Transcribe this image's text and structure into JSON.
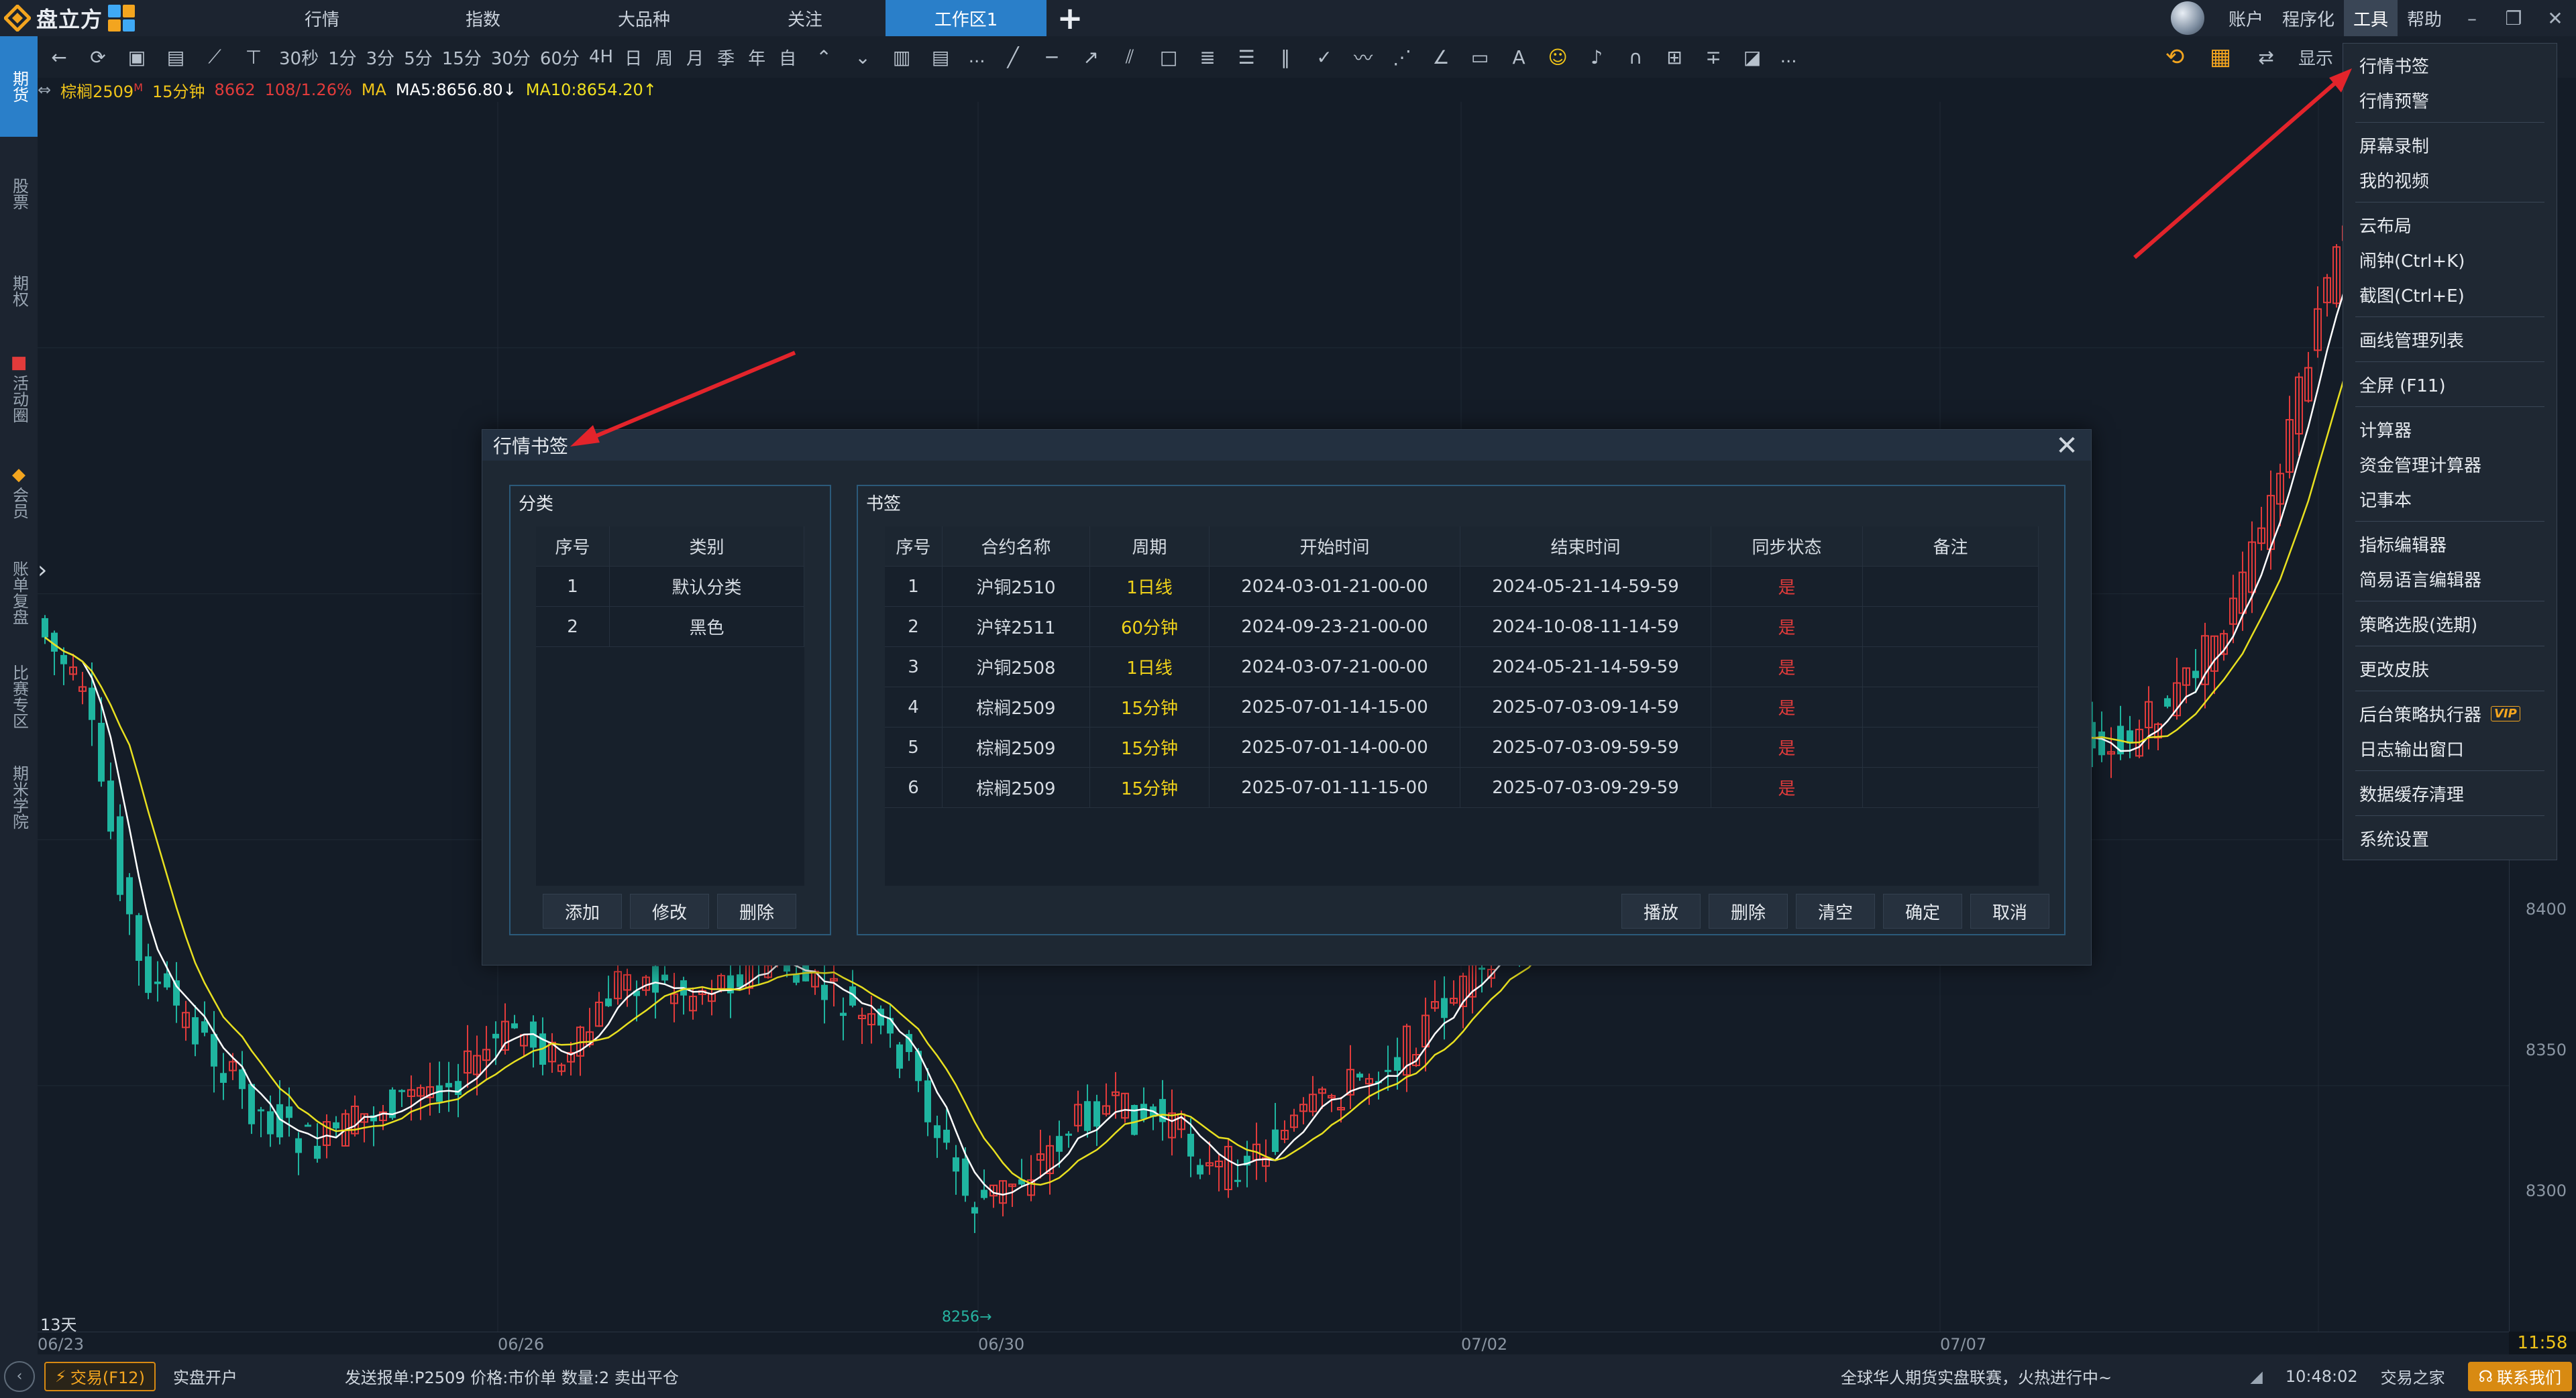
{
  "app": {
    "logo_text": "盘立方",
    "tabs": [
      "行情",
      "指数",
      "大品种",
      "关注",
      "工作区1"
    ],
    "active_tab": "工作区1",
    "right_menus": [
      "账户",
      "程序化",
      "工具",
      "帮助"
    ],
    "window_controls": [
      "minimize-icon",
      "restore-icon",
      "close-icon"
    ]
  },
  "toolbar": {
    "periods": [
      "30秒",
      "1分",
      "3分",
      "5分",
      "15分",
      "30分",
      "60分",
      "4H",
      "日",
      "周",
      "月",
      "季",
      "年",
      "自"
    ],
    "more": "...",
    "display_label": "显示"
  },
  "sidebar": {
    "items": [
      "期货",
      "股票",
      "期权",
      "活动圈",
      "会员",
      "账单复盘",
      "比赛专区",
      "期米学院"
    ]
  },
  "chart": {
    "info": {
      "symbol": "棕榈2509",
      "symbol_badge": "M",
      "period": "15分钟",
      "price": "8662",
      "change": "108/1.26%",
      "ma_label": "MA",
      "ma5": "MA5:8656.80↓",
      "ma10": "MA10:8654.20↑"
    },
    "days_label": "13天",
    "min_label": "8256→",
    "price_ticks": [
      "8400",
      "8350",
      "8300"
    ],
    "time_ticks": [
      "06/23",
      "06/26",
      "06/30",
      "07/02",
      "07/07"
    ],
    "clock": "11:58",
    "colors": {
      "up": "#e23b3b",
      "down": "#1fb5a0",
      "ma5": "#ffffff",
      "ma10": "#e8e020",
      "accent": "#2a7fc9"
    }
  },
  "dropdown": {
    "groups": [
      [
        "行情书签",
        "行情预警"
      ],
      [
        "屏幕录制",
        "我的视频"
      ],
      [
        "云布局",
        "闹钟(Ctrl+K)",
        "截图(Ctrl+E)"
      ],
      [
        "画线管理列表"
      ],
      [
        "全屏 (F11)"
      ],
      [
        "计算器",
        "资金管理计算器",
        "记事本"
      ],
      [
        "指标编辑器",
        "简易语言编辑器"
      ],
      [
        "策略选股(选期)"
      ],
      [
        "更改皮肤"
      ],
      [
        "后台策略执行器",
        "日志输出窗口"
      ],
      [
        "数据缓存清理"
      ],
      [
        "系统设置"
      ]
    ],
    "vip_label": "VIP"
  },
  "dialog": {
    "title": "行情书签",
    "category": {
      "title": "分类",
      "headers": [
        "序号",
        "类别"
      ],
      "rows": [
        [
          "1",
          "默认分类"
        ],
        [
          "2",
          "黑色"
        ]
      ],
      "buttons": [
        "添加",
        "修改",
        "删除"
      ]
    },
    "bookmarks": {
      "title": "书签",
      "headers": [
        "序号",
        "合约名称",
        "周期",
        "开始时间",
        "结束时间",
        "同步状态",
        "备注"
      ],
      "rows": [
        [
          "1",
          "沪铜2510",
          "1日线",
          "2024-03-01-21-00-00",
          "2024-05-21-14-59-59",
          "是",
          ""
        ],
        [
          "2",
          "沪锌2511",
          "60分钟",
          "2024-09-23-21-00-00",
          "2024-10-08-11-14-59",
          "是",
          ""
        ],
        [
          "3",
          "沪铜2508",
          "1日线",
          "2024-03-07-21-00-00",
          "2024-05-21-14-59-59",
          "是",
          ""
        ],
        [
          "4",
          "棕榈2509",
          "15分钟",
          "2025-07-01-14-15-00",
          "2025-07-03-09-14-59",
          "是",
          ""
        ],
        [
          "5",
          "棕榈2509",
          "15分钟",
          "2025-07-01-14-00-00",
          "2025-07-03-09-59-59",
          "是",
          ""
        ],
        [
          "6",
          "棕榈2509",
          "15分钟",
          "2025-07-01-11-15-00",
          "2025-07-03-09-29-59",
          "是",
          ""
        ]
      ],
      "buttons": [
        "播放",
        "删除",
        "清空",
        "确定",
        "取消"
      ]
    }
  },
  "statusbar": {
    "trade": "交易(F12)",
    "open_account": "实盘开户",
    "order_text": "发送报单:P2509 价格:市价单  数量:2 卖出平仓",
    "marquee": "全球华人期货实盘联赛，火热进行中~",
    "time": "10:48:02",
    "home": "交易之家",
    "contact": "联系我们"
  }
}
